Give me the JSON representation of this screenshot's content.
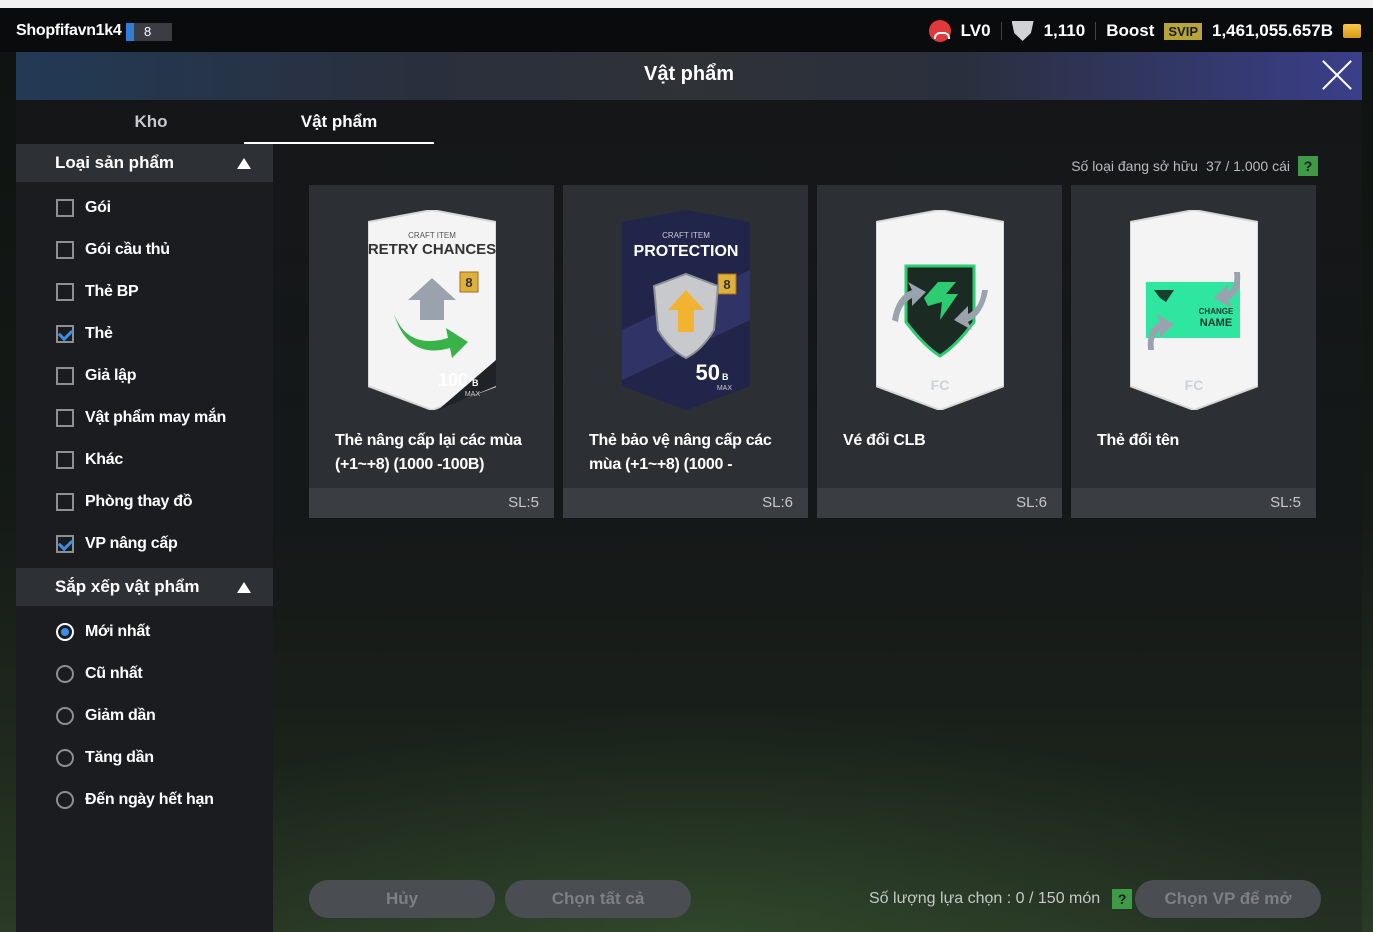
{
  "topbar": {
    "username": "Shopfifavn1k4",
    "level_badge": "8",
    "rank": "LV0",
    "trophies": "1,110",
    "boost": "Boost",
    "svip": "SVIP",
    "coins": "1,461,055.657B"
  },
  "header": {
    "title": "Vật phẩm"
  },
  "tabs": [
    {
      "label": "Kho"
    },
    {
      "label": "Vật phẩm"
    }
  ],
  "sidebar": {
    "category": {
      "title": "Loại sản phẩm",
      "items": [
        {
          "label": "Gói",
          "checked": false
        },
        {
          "label": "Gói cầu thủ",
          "checked": false
        },
        {
          "label": "Thẻ BP",
          "checked": false
        },
        {
          "label": "Thẻ",
          "checked": true
        },
        {
          "label": "Giả lập",
          "checked": false
        },
        {
          "label": "Vật phẩm may mắn",
          "checked": false
        },
        {
          "label": "Khác",
          "checked": false
        },
        {
          "label": "Phòng thay đồ",
          "checked": false
        },
        {
          "label": "VP nâng cấp",
          "checked": true
        }
      ]
    },
    "sort": {
      "title": "Sắp xếp vật phẩm",
      "items": [
        {
          "label": "Mới nhất",
          "selected": true
        },
        {
          "label": "Cũ nhất",
          "selected": false
        },
        {
          "label": "Giảm dần",
          "selected": false
        },
        {
          "label": "Tăng dần",
          "selected": false
        },
        {
          "label": "Đến ngày hết hạn",
          "selected": false
        }
      ]
    }
  },
  "main": {
    "owned_label": "Số loại đang sở hữu",
    "owned_value": "37 / 1.000 cái",
    "help": "?",
    "items": [
      {
        "name": "Thẻ nâng cấp lại các mùa (+1~+8) (1000 -100B)",
        "qty": "SL:5",
        "art": {
          "top": "CRAFT ITEM",
          "title": "RETRY CHANCES",
          "badge": "8",
          "value": "100",
          "unit": "B",
          "sub": "MAX"
        }
      },
      {
        "name": "Thẻ bảo vệ nâng cấp các mùa (+1~+8) (1000 -",
        "qty": "SL:6",
        "art": {
          "top": "CRAFT ITEM",
          "title": "PROTECTION",
          "badge": "8",
          "value": "50",
          "unit": "B",
          "sub": "MAX"
        }
      },
      {
        "name": "Vé đổi CLB",
        "qty": "SL:6",
        "art": {}
      },
      {
        "name": "Thẻ đổi tên",
        "qty": "SL:5",
        "art": {
          "line1": "CHANGE",
          "line2": "NAME"
        }
      }
    ]
  },
  "bottom": {
    "cancel": "Hủy",
    "select_all": "Chọn tất cả",
    "selection_label": "Số lượng lựa chọn : 0 / 150 món",
    "help": "?",
    "open": "Chọn VP để mở"
  },
  "colors": {
    "accent": "#3b8fe8",
    "help_green": "#3f9a48",
    "svip": "#b7a53a",
    "card_bg": "#2c2f33"
  }
}
